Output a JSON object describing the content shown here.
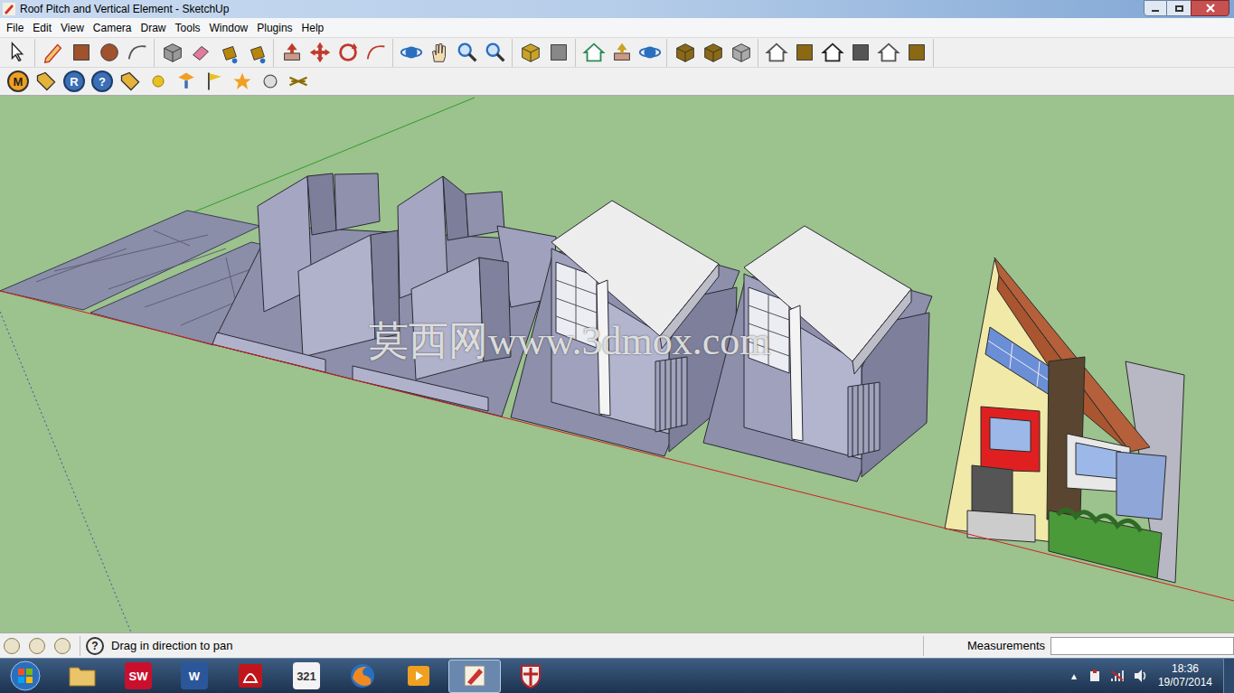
{
  "window": {
    "title": "Roof Pitch and Vertical Element - SketchUp"
  },
  "menu": [
    "File",
    "Edit",
    "View",
    "Camera",
    "Draw",
    "Tools",
    "Window",
    "Plugins",
    "Help"
  ],
  "toolbar_secondary": [
    {
      "kind": "badge",
      "label": "M"
    },
    {
      "kind": "tag"
    },
    {
      "kind": "circle-letter",
      "label": "R"
    },
    {
      "kind": "circle-letter",
      "label": "?"
    },
    {
      "kind": "tag"
    },
    {
      "kind": "ball"
    },
    {
      "kind": "dropper"
    },
    {
      "kind": "flag"
    },
    {
      "kind": "star"
    },
    {
      "kind": "sphere"
    },
    {
      "kind": "cross"
    }
  ],
  "viewport": {
    "watermark": "莫西网www.3dmox.com"
  },
  "status_bar": {
    "help_icon": "?",
    "hint": "Drag in direction to pan",
    "measurements_label": "Measurements",
    "measurements_value": ""
  },
  "taskbar": {
    "apps": [
      {
        "kind": "folder",
        "selected": false
      },
      {
        "kind": "solidworks",
        "label": "SW",
        "selected": false
      },
      {
        "kind": "word",
        "label": "W",
        "selected": false
      },
      {
        "kind": "acrobat",
        "selected": false
      },
      {
        "kind": "video",
        "label": "321",
        "selected": false
      },
      {
        "kind": "firefox",
        "selected": false
      },
      {
        "kind": "player",
        "selected": false
      },
      {
        "kind": "sketchup",
        "selected": true
      },
      {
        "kind": "shield",
        "selected": false
      }
    ],
    "tray_arrow": "▲",
    "time": "18:36",
    "date": "19/07/2014"
  }
}
